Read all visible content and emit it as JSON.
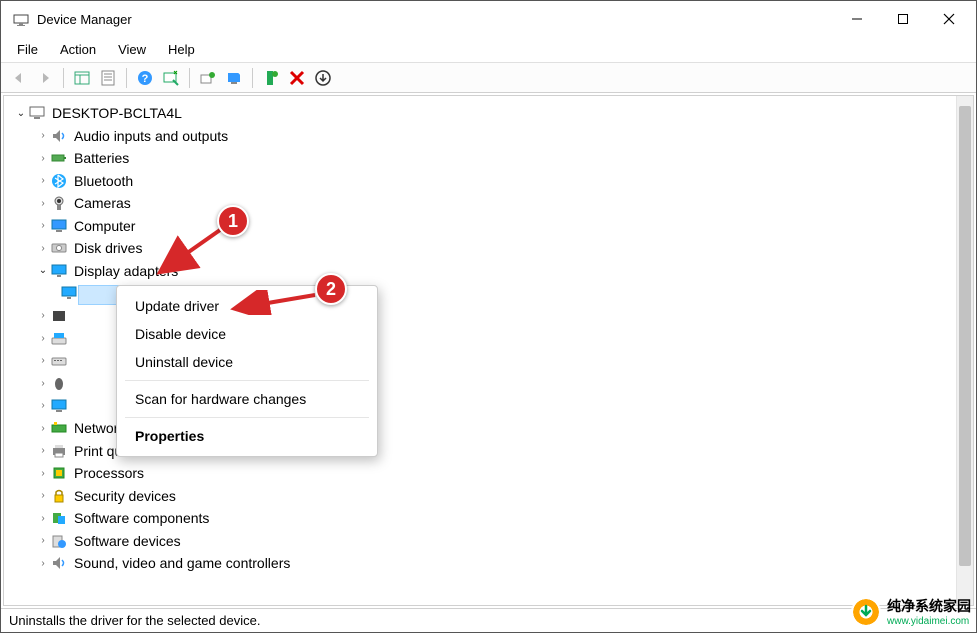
{
  "window": {
    "title": "Device Manager"
  },
  "menus": {
    "file": "File",
    "action": "Action",
    "view": "View",
    "help": "Help"
  },
  "tree": {
    "root": "DESKTOP-BCLTA4L",
    "items": [
      "Audio inputs and outputs",
      "Batteries",
      "Bluetooth",
      "Cameras",
      "Computer",
      "Disk drives",
      "Display adapters",
      "Network adapters",
      "Print queues",
      "Processors",
      "Security devices",
      "Software components",
      "Software devices",
      "Sound, video and game controllers"
    ]
  },
  "context_menu": {
    "update": "Update driver",
    "disable": "Disable device",
    "uninstall": "Uninstall device",
    "scan": "Scan for hardware changes",
    "properties": "Properties"
  },
  "statusbar": "Uninstalls the driver for the selected device.",
  "annotations": {
    "badge1": "1",
    "badge2": "2"
  },
  "watermark": {
    "text": "纯净系统家园",
    "url": "www.yidaimei.com"
  }
}
